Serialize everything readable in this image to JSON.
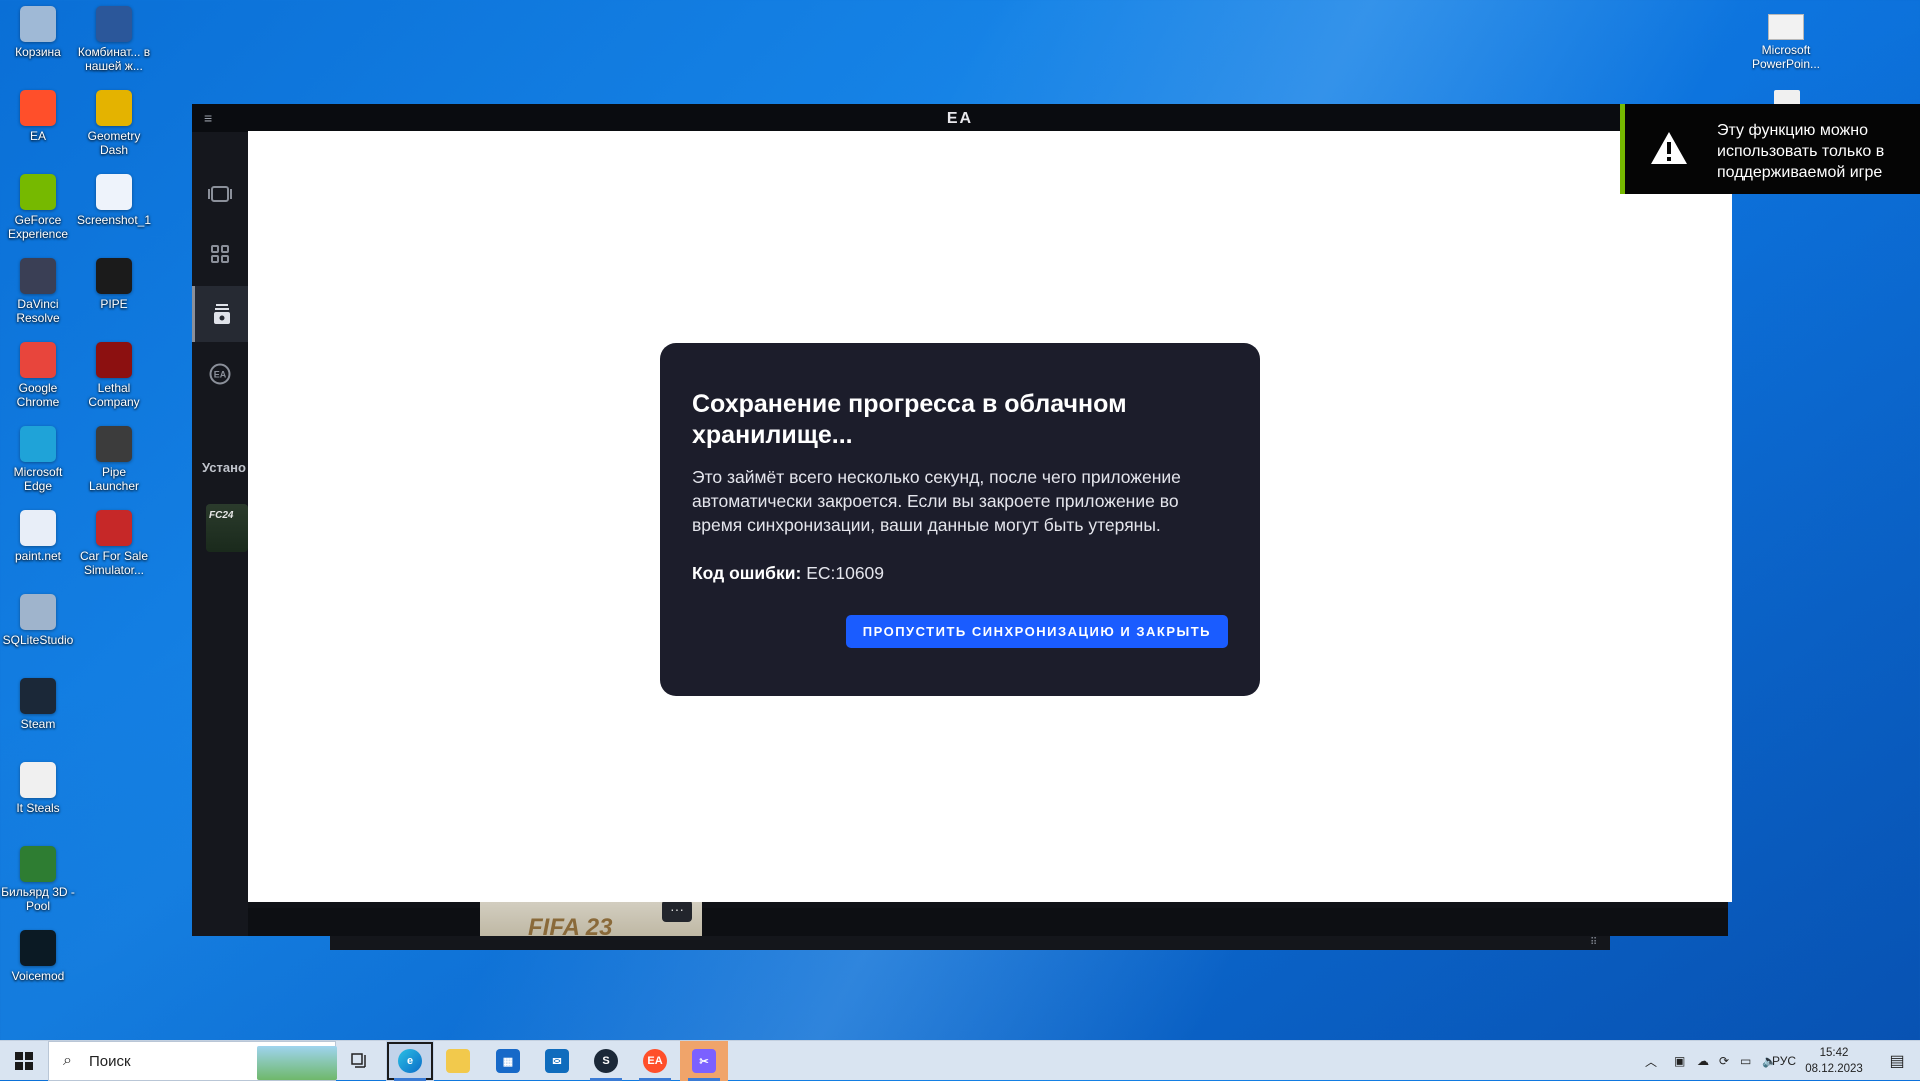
{
  "desktop": {
    "icons_left": [
      {
        "label": "Корзина",
        "icon": "recycle-bin-icon",
        "color": "#9fb9d6"
      },
      {
        "label": "Комбинат... в нашей ж...",
        "icon": "word-document-icon",
        "color": "#2b579a"
      },
      {
        "label": "EA",
        "icon": "ea-icon",
        "color": "#ff4f2a"
      },
      {
        "label": "Geometry Dash",
        "icon": "geometry-dash-icon",
        "color": "#e4b300"
      },
      {
        "label": "GeForce Experience",
        "icon": "geforce-icon",
        "color": "#76b900"
      },
      {
        "label": "Screenshot_1",
        "icon": "image-file-icon",
        "color": "#eef3fb"
      },
      {
        "label": "DaVinci Resolve",
        "icon": "davinci-icon",
        "color": "#3a3f55"
      },
      {
        "label": "PIPE",
        "icon": "pipe-icon",
        "color": "#1b1b1b"
      },
      {
        "label": "Google Chrome",
        "icon": "chrome-icon",
        "color": "#e8453c"
      },
      {
        "label": "Lethal Company",
        "icon": "lethal-company-icon",
        "color": "#8c1010"
      },
      {
        "label": "Microsoft Edge",
        "icon": "edge-icon",
        "color": "#1fa3d8"
      },
      {
        "label": "Pipe Launcher",
        "icon": "pipe-launcher-icon",
        "color": "#3c3c3c"
      },
      {
        "label": "paint.net",
        "icon": "paintnet-icon",
        "color": "#e8eef8"
      },
      {
        "label": "Car For Sale Simulator...",
        "icon": "car-for-sale-icon",
        "color": "#c62828"
      },
      {
        "label": "SQLiteStudio",
        "icon": "sqlitestudio-icon",
        "color": "#9fb4cc"
      },
      {
        "label": "Steam",
        "icon": "steam-icon",
        "color": "#1b2838"
      },
      {
        "label": "It Steals",
        "icon": "it-steals-icon",
        "color": "#f0f0f0"
      },
      {
        "label": "Бильярд 3D - Pool",
        "icon": "billiards-icon",
        "color": "#2e7d32"
      },
      {
        "label": "Voicemod",
        "icon": "voicemod-icon",
        "color": "#0b1a24"
      }
    ],
    "icon_right": {
      "label": "Microsoft PowerPoin...",
      "icon": "powerpoint-file-icon"
    }
  },
  "ea_app": {
    "title": "EA",
    "sidebar_section_label": "Устано",
    "sidebar_game_thumb": "FC24",
    "game_tile_label": "FIFA 23",
    "more_label": "···"
  },
  "dialog": {
    "title": "Сохранение прогресса в облачном хранилище...",
    "body": "Это займёт всего несколько секунд, после чего приложение автоматически закроется. Если вы закроете приложение во время синхронизации, ваши данные могут быть утеряны.",
    "error_label": "Код ошибки:",
    "error_code": "EC:10609",
    "button_label": "ПРОПУСТИТЬ СИНХРОНИЗАЦИЮ И ЗАКРЫТЬ",
    "accent_color": "#1a5cff"
  },
  "notification": {
    "text": "Эту функцию можно использовать только в поддерживаемой игре",
    "accent_color": "#76b900"
  },
  "taskbar": {
    "search_placeholder": "Поиск",
    "apps": [
      {
        "name": "task-view",
        "label": ""
      },
      {
        "name": "edge",
        "label": ""
      },
      {
        "name": "file-explorer",
        "label": ""
      },
      {
        "name": "microsoft-store",
        "label": ""
      },
      {
        "name": "mail",
        "label": ""
      },
      {
        "name": "steam",
        "label": ""
      },
      {
        "name": "ea",
        "label": "EA"
      },
      {
        "name": "snipping",
        "label": ""
      }
    ],
    "language": "РУС",
    "time": "15:42",
    "date": "08.12.2023"
  }
}
